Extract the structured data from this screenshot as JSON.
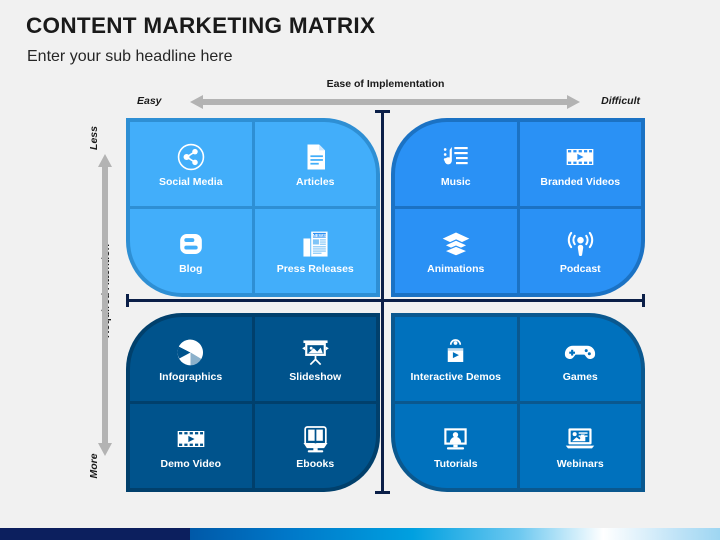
{
  "header": {
    "title": "CONTENT MARKETING MATRIX",
    "subtitle": "Enter your sub headline here"
  },
  "axes": {
    "x": {
      "title": "Ease of Implementation",
      "left_label": "Easy",
      "right_label": "Difficult",
      "arrow_color": "#b3b3b3"
    },
    "y": {
      "title": "Required Attention",
      "top_label": "Less",
      "bottom_label": "More",
      "arrow_color": "#b3b3b3"
    }
  },
  "matrix": {
    "divider_color": "#0b1f48",
    "quadrants": [
      {
        "id": "top-left",
        "position": "easy-less-attention",
        "fill": "#42aefa",
        "border": "#2e8fd4",
        "cells": [
          {
            "label": "Social Media",
            "icon": "share-icon"
          },
          {
            "label": "Articles",
            "icon": "document-icon"
          },
          {
            "label": "Blog",
            "icon": "blogger-icon"
          },
          {
            "label": "Press Releases",
            "icon": "newspaper-icon"
          }
        ]
      },
      {
        "id": "top-right",
        "position": "difficult-less-attention",
        "fill": "#2a91f5",
        "border": "#1b72c4",
        "cells": [
          {
            "label": "Music",
            "icon": "music-note-icon"
          },
          {
            "label": "Branded Videos",
            "icon": "film-play-icon"
          },
          {
            "label": "Animations",
            "icon": "layers-icon"
          },
          {
            "label": "Podcast",
            "icon": "podcast-icon"
          }
        ]
      },
      {
        "id": "bottom-left",
        "position": "easy-more-attention",
        "fill": "#00538c",
        "border": "#01406c",
        "cells": [
          {
            "label": "Infographics",
            "icon": "pie-chart-icon"
          },
          {
            "label": "Slideshow",
            "icon": "presentation-screen-icon"
          },
          {
            "label": "Demo Video",
            "icon": "film-play-icon"
          },
          {
            "label": "Ebooks",
            "icon": "open-book-icon"
          }
        ]
      },
      {
        "id": "bottom-right",
        "position": "difficult-more-attention",
        "fill": "#0071bd",
        "border": "#0a588f",
        "cells": [
          {
            "label": "Interactive Demos",
            "icon": "interactive-play-icon"
          },
          {
            "label": "Games",
            "icon": "gamepad-icon"
          },
          {
            "label": "Tutorials",
            "icon": "monitor-person-icon"
          },
          {
            "label": "Webinars",
            "icon": "laptop-presentation-icon"
          }
        ]
      }
    ]
  },
  "footer": {
    "navy_color": "#0c1f5e",
    "gradient_from": "#0059a8",
    "gradient_to": "#9ed6f2"
  }
}
